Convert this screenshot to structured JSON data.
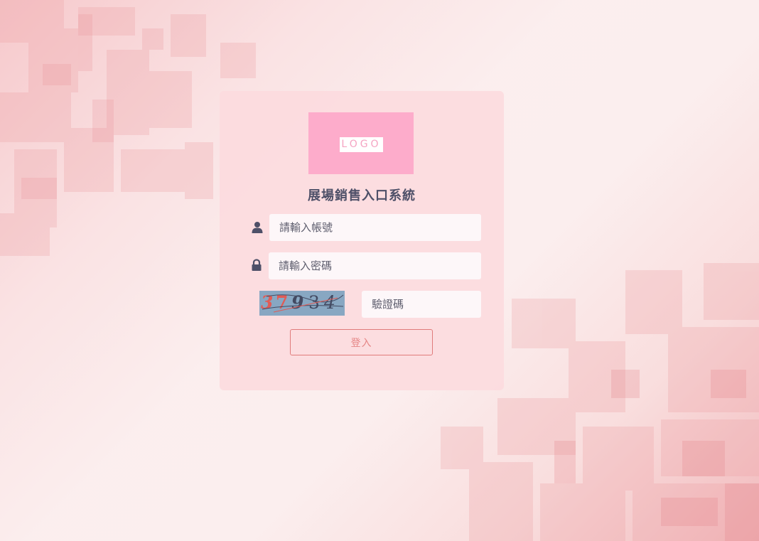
{
  "logo": {
    "text": "LOGO",
    "color": "#fdaccb"
  },
  "title": "展場銷售入口系統",
  "form": {
    "username_placeholder": "請輸入帳號",
    "password_placeholder": "請輸入密碼",
    "captcha_placeholder": "驗證碼",
    "captcha_chars": [
      "3",
      "7",
      "9",
      "3",
      "4"
    ],
    "login_label": "登入"
  },
  "icons": {
    "username": "user-icon",
    "password": "lock-icon"
  },
  "colors": {
    "accent": "#e07b7b",
    "title": "#4e5068",
    "card": "#fcdbde"
  }
}
